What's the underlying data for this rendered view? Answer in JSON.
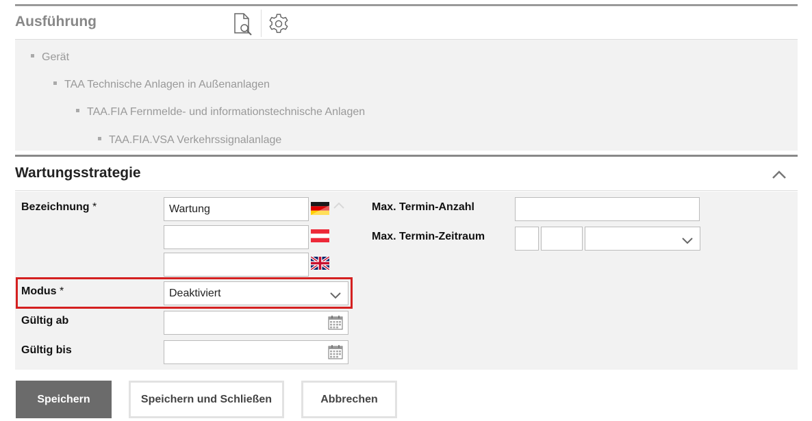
{
  "ausfuehrung": {
    "title": "Ausführung",
    "tree": [
      {
        "label": "Gerät"
      },
      {
        "label": "TAA Technische Anlagen in Außenanlagen"
      },
      {
        "label": "TAA.FIA Fernmelde- und informationstechnische Anlagen"
      },
      {
        "label": "TAA.FIA.VSA Verkehrssignalanlage"
      }
    ]
  },
  "wartungsstrategie": {
    "title": "Wartungsstrategie",
    "bezeichnung": {
      "label": "Bezeichnung",
      "required": "*",
      "value_de": "Wartung",
      "value_at": "",
      "value_en": ""
    },
    "modus": {
      "label": "Modus",
      "required": "*",
      "selected": "Deaktiviert"
    },
    "gueltig_ab": {
      "label": "Gültig ab",
      "value": ""
    },
    "gueltig_bis": {
      "label": "Gültig bis",
      "value": ""
    },
    "max_termin_anzahl": {
      "label": "Max. Termin-Anzahl",
      "value": ""
    },
    "max_termin_zeitraum": {
      "label": "Max. Termin-Zeitraum",
      "value1": "",
      "value2": "",
      "unit": ""
    }
  },
  "buttons": {
    "save": "Speichern",
    "save_close": "Speichern und Schließen",
    "cancel": "Abbrechen"
  },
  "colors": {
    "highlight": "#d42020",
    "primary_button": "#6b6b6b",
    "panel_bg": "#f2f2f2"
  },
  "icons": [
    "document-search-icon",
    "gear-icon",
    "chevron-up-icon",
    "chevron-down-icon",
    "calendar-icon",
    "flag-de-icon",
    "flag-at-icon",
    "flag-uk-icon"
  ]
}
